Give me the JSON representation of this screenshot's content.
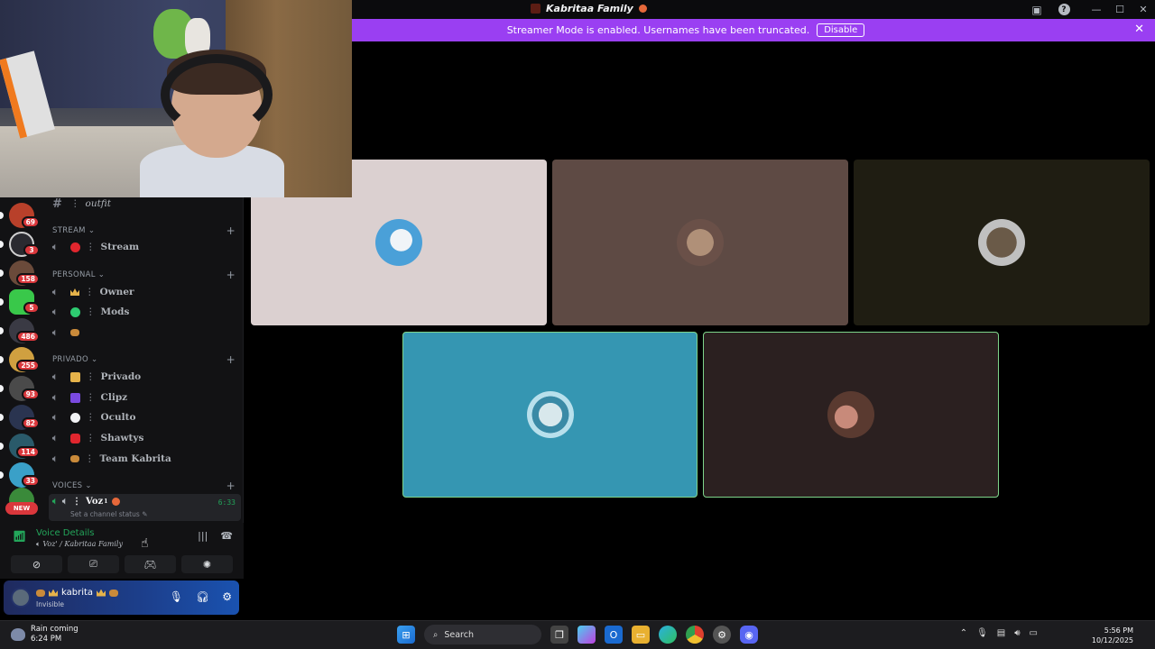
{
  "window": {
    "title": "Kabritaa Family",
    "help_icon": "help-icon",
    "inbox_icon": "inbox-icon"
  },
  "banner": {
    "text": "Streamer Mode is enabled. Usernames have been truncated.",
    "button": "Disable",
    "bg": "#9a3ff2"
  },
  "servers": [
    {
      "badge": "69",
      "color": "#b8402a"
    },
    {
      "badge": "3",
      "color": "#2a2a30"
    },
    {
      "badge": "158",
      "color": "#6a4a3a"
    },
    {
      "badge": "5",
      "color": "#39c84a"
    },
    {
      "badge": "486",
      "color": "#3a3a44"
    },
    {
      "badge": "255",
      "color": "#d0a040"
    },
    {
      "badge": "93",
      "color": "#4a4a4a"
    },
    {
      "badge": "82",
      "color": "#2a3450"
    },
    {
      "badge": "114",
      "color": "#2a5a6a"
    },
    {
      "badge": "33",
      "color": "#3aa0c8"
    },
    {
      "badge": "NEW",
      "color": "#3a8a3a"
    }
  ],
  "channels": {
    "top_channel": {
      "prefix": "#",
      "name": "outfit"
    },
    "categories": [
      {
        "label": "STREAM",
        "channels": [
          {
            "name": "Stream",
            "emoji_color": "#e0262e"
          }
        ]
      },
      {
        "label": "PERSONAL",
        "channels": [
          {
            "name": "Owner",
            "emoji_color": "#e6b34a"
          },
          {
            "name": "Mods",
            "emoji_color": "#2ecc71"
          },
          {
            "name": "",
            "emoji_color": "#c98a3a"
          }
        ]
      },
      {
        "label": "PRIVADO",
        "channels": [
          {
            "name": "Privado",
            "emoji_color": "#e6b34a"
          },
          {
            "name": "Clipz",
            "emoji_color": "#7a4ae0"
          },
          {
            "name": "Oculto",
            "emoji_color": "#f2f3f5"
          },
          {
            "name": "Shawtys",
            "emoji_color": "#e0262e"
          },
          {
            "name": "Team Kabrita",
            "emoji_color": "#c98a3a"
          }
        ]
      },
      {
        "label": "VOICES",
        "channels": []
      }
    ],
    "active_voice": {
      "name": "Voz",
      "superscript": "1",
      "time": "6:33",
      "status_placeholder": "Set a channel status"
    }
  },
  "voice_panel": {
    "title": "Voice Details",
    "subtitle": "Voz' / Kabritaa Family"
  },
  "user": {
    "name": "kabrita",
    "status": "Invisible"
  },
  "stage": {
    "tiles": [
      {
        "bg": "#dbd0d0",
        "avatar": "#4aa0d8",
        "speaking": false
      },
      {
        "bg": "#5e4a44",
        "avatar": "#8a7060",
        "speaking": false
      },
      {
        "bg": "#1f1d12",
        "avatar": "#9a9a9a",
        "speaking": false
      },
      {
        "bg": "#3596b2",
        "avatar": "#b8d8e0",
        "speaking": true
      },
      {
        "bg": "#2b2020",
        "avatar": "#c88a7a",
        "speaking": true
      }
    ]
  },
  "taskbar": {
    "weather_title": "Rain coming",
    "weather_time": "6:24 PM",
    "search_placeholder": "Search",
    "time": "5:56 PM",
    "date": "10/12/2025"
  }
}
